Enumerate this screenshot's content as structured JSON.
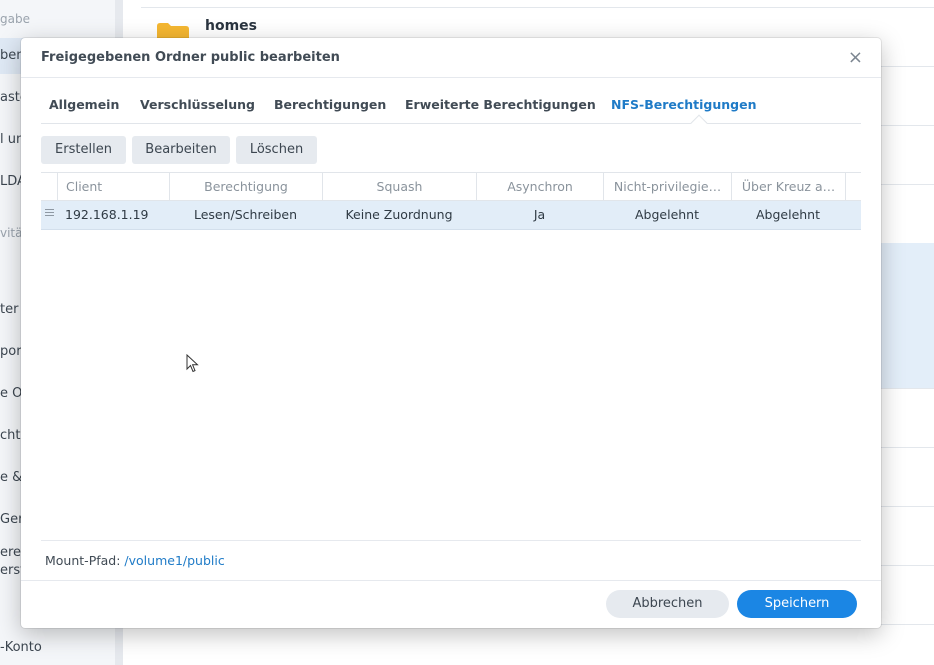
{
  "background": {
    "sidebar": {
      "group1": "gabe",
      "items": [
        "ben",
        "aste",
        "l un",
        "LDA"
      ],
      "group2": "vitä",
      "items2": [
        "ter",
        "por",
        "e O",
        "chti",
        "e &",
        "Ger",
        "erer",
        "erst"
      ],
      "bottom_item": "-Konto"
    },
    "list": {
      "first_folder": "homes"
    }
  },
  "dialog": {
    "title": "Freigegebenen Ordner public bearbeiten",
    "close_glyph": "×",
    "tabs": [
      {
        "label": "Allgemein"
      },
      {
        "label": "Verschlüsselung"
      },
      {
        "label": "Berechtigungen"
      },
      {
        "label": "Erweiterte Berechtigungen"
      },
      {
        "label": "NFS-Berechtigungen"
      }
    ],
    "active_tab": "NFS-Berechtigungen",
    "toolbar": {
      "create": "Erstellen",
      "edit": "Bearbeiten",
      "delete": "Löschen"
    },
    "grid": {
      "columns": [
        "Client",
        "Berechtigung",
        "Squash",
        "Asynchron",
        "Nicht-privilegie…",
        "Über Kreuz a…"
      ],
      "rows": [
        {
          "client": "192.168.1.19",
          "permission": "Lesen/Schreiben",
          "squash": "Keine Zuordnung",
          "async": "Ja",
          "non_privileged": "Abgelehnt",
          "cross_mount": "Abgelehnt"
        }
      ]
    },
    "mount": {
      "label": "Mount-Pfad:",
      "path": "/volume1/public"
    },
    "buttons": {
      "cancel": "Abbrechen",
      "save": "Speichern"
    }
  },
  "colors": {
    "accent": "#1f7bc7",
    "primary_button": "#1b86e4",
    "selected_row": "#e2edf8"
  }
}
